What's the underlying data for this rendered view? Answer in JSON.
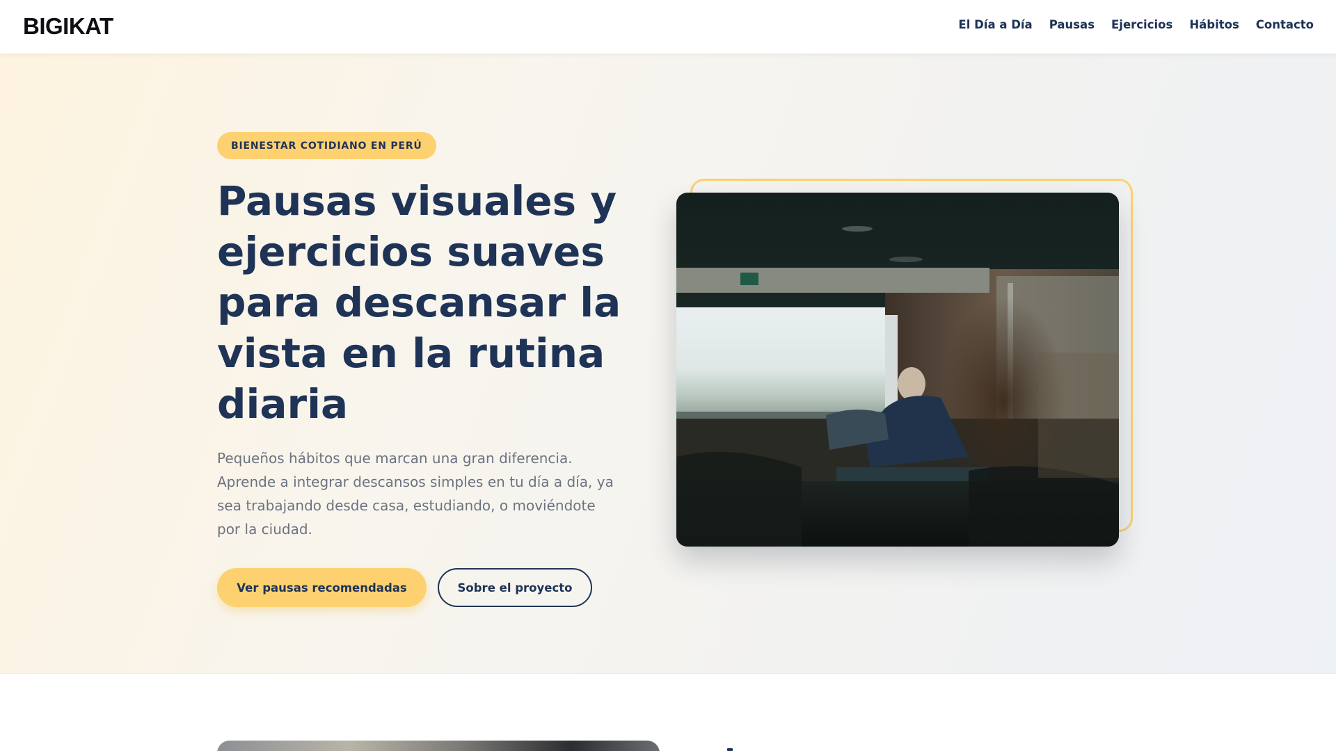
{
  "header": {
    "logo": "BIGIKAT",
    "nav": [
      "El Día a Día",
      "Pausas",
      "Ejercicios",
      "Hábitos",
      "Contacto"
    ]
  },
  "hero": {
    "badge": "BIENESTAR COTIDIANO EN PERÚ",
    "title": "Pausas visuales y ejercicios suaves para descansar la vista en la rutina diaria",
    "description": "Pequeños hábitos que marcan una gran diferencia. Aprende a integrar descansos simples en tu día a día, ya sea trabajando desde casa, estudiando, o moviéndote por la ciudad.",
    "primary_button": "Ver pausas recomendadas",
    "secondary_button": "Sobre el proyecto"
  },
  "colors": {
    "accent": "#fdd170",
    "navy": "#1e3356",
    "muted_text": "#6b7380"
  }
}
